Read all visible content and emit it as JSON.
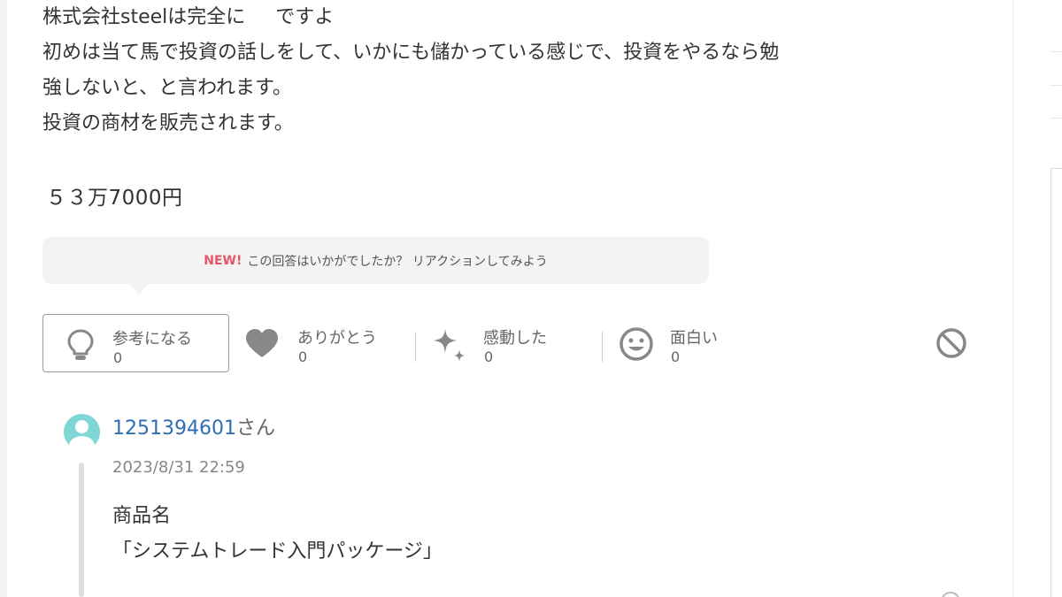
{
  "answer": {
    "lines": [
      "株式会社steelは完全に",
      "初めは当て馬で投資の話しをして、いかにも儲かっている感じで、投資をやるなら勉",
      "強しないと、と言われます。",
      "投資の商材を販売されます。"
    ],
    "line1_tail": "ですよ",
    "price": "５３万7000円"
  },
  "reaction_prompt": {
    "badge": "NEW!",
    "text": "この回答はいかがでしたか？ リアクションしてみよう"
  },
  "reactions": [
    {
      "label": "参考になる",
      "count": "0",
      "icon": "lightbulb-icon"
    },
    {
      "label": "ありがとう",
      "count": "0",
      "icon": "heart-icon"
    },
    {
      "label": "感動した",
      "count": "0",
      "icon": "sparkle-icon"
    },
    {
      "label": "面白い",
      "count": "0",
      "icon": "smile-icon"
    }
  ],
  "report_icon": "prohibit-icon",
  "reply": {
    "user_id": "1251394601",
    "user_suffix": "さん",
    "timestamp": "2023/8/31 22:59",
    "lines": [
      "商品名",
      "「システムトレード入門パッケージ」"
    ]
  },
  "colors": {
    "link": "#2f6eb5",
    "new_badge": "#e9546b",
    "avatar": "#7fd6d4"
  }
}
